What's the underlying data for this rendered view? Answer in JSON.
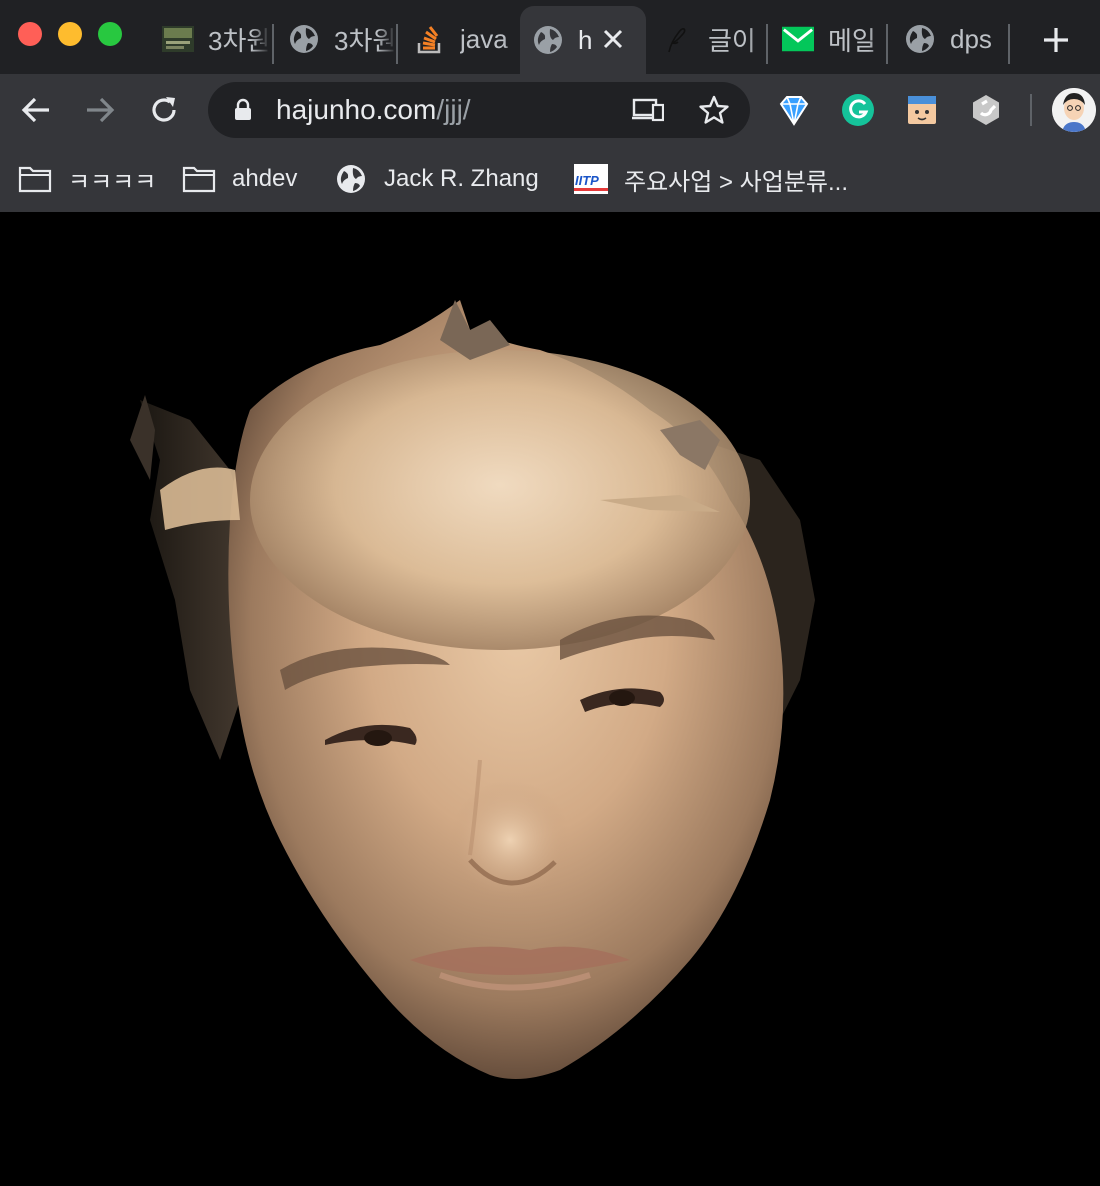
{
  "tabs": [
    {
      "title": "3차원",
      "icon": "coding-thumbnail-icon"
    },
    {
      "title": "3차원",
      "icon": "globe-icon"
    },
    {
      "title": "java",
      "icon": "stackoverflow-icon"
    },
    {
      "title": "h",
      "icon": "globe-icon",
      "active": true
    },
    {
      "title": "글이",
      "icon": "pen-icon"
    },
    {
      "title": "메일",
      "icon": "mail-icon"
    },
    {
      "title": "dps",
      "icon": "globe-icon"
    }
  ],
  "toolbar": {
    "url_host": "hajunho.com",
    "url_path": "/jjj/",
    "extensions": [
      "diamond-extension-icon",
      "grammarly-icon",
      "robot-extension-icon",
      "magnet-extension-icon"
    ]
  },
  "bookmarks": [
    {
      "label": "ㅋㅋㅋㅋ",
      "icon": "folder-icon"
    },
    {
      "label": "ahdev",
      "icon": "folder-icon"
    },
    {
      "label": "Jack R. Zhang",
      "icon": "globe-icon"
    },
    {
      "label": "주요사업 > 사업분류...",
      "icon": "iitp-icon"
    }
  ],
  "colors": {
    "close": "#ff5f57",
    "minimize": "#febc2e",
    "maximize": "#28c840",
    "frame": "#202124",
    "toolbar": "#35363a"
  },
  "content": {
    "subject": "3d-face-scan-render"
  }
}
